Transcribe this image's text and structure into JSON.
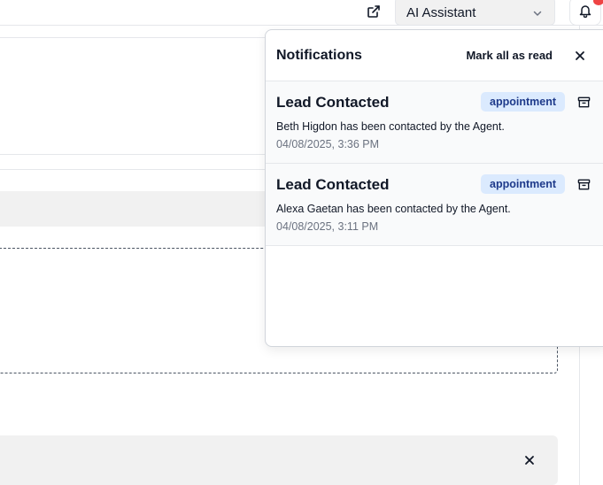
{
  "topbar": {
    "external_link_icon": "external-link-icon",
    "assistant_select": {
      "value": "AI Assistant"
    },
    "bell_icon": "bell-icon",
    "has_unread_dot": true
  },
  "notifications": {
    "title": "Notifications",
    "mark_all_label": "Mark all as read",
    "items": [
      {
        "title": "Lead Contacted",
        "badge": "appointment",
        "body": "Beth Higdon has been contacted by the Agent.",
        "time": "04/08/2025, 3:36 PM"
      },
      {
        "title": "Lead Contacted",
        "badge": "appointment",
        "body": "Alexa Gaetan has been contacted by the Agent.",
        "time": "04/08/2025, 3:11 PM"
      }
    ]
  },
  "colors": {
    "badge_bg": "#dbeafe",
    "badge_text": "#1e3a8a",
    "unread_dot": "#ef4444"
  }
}
